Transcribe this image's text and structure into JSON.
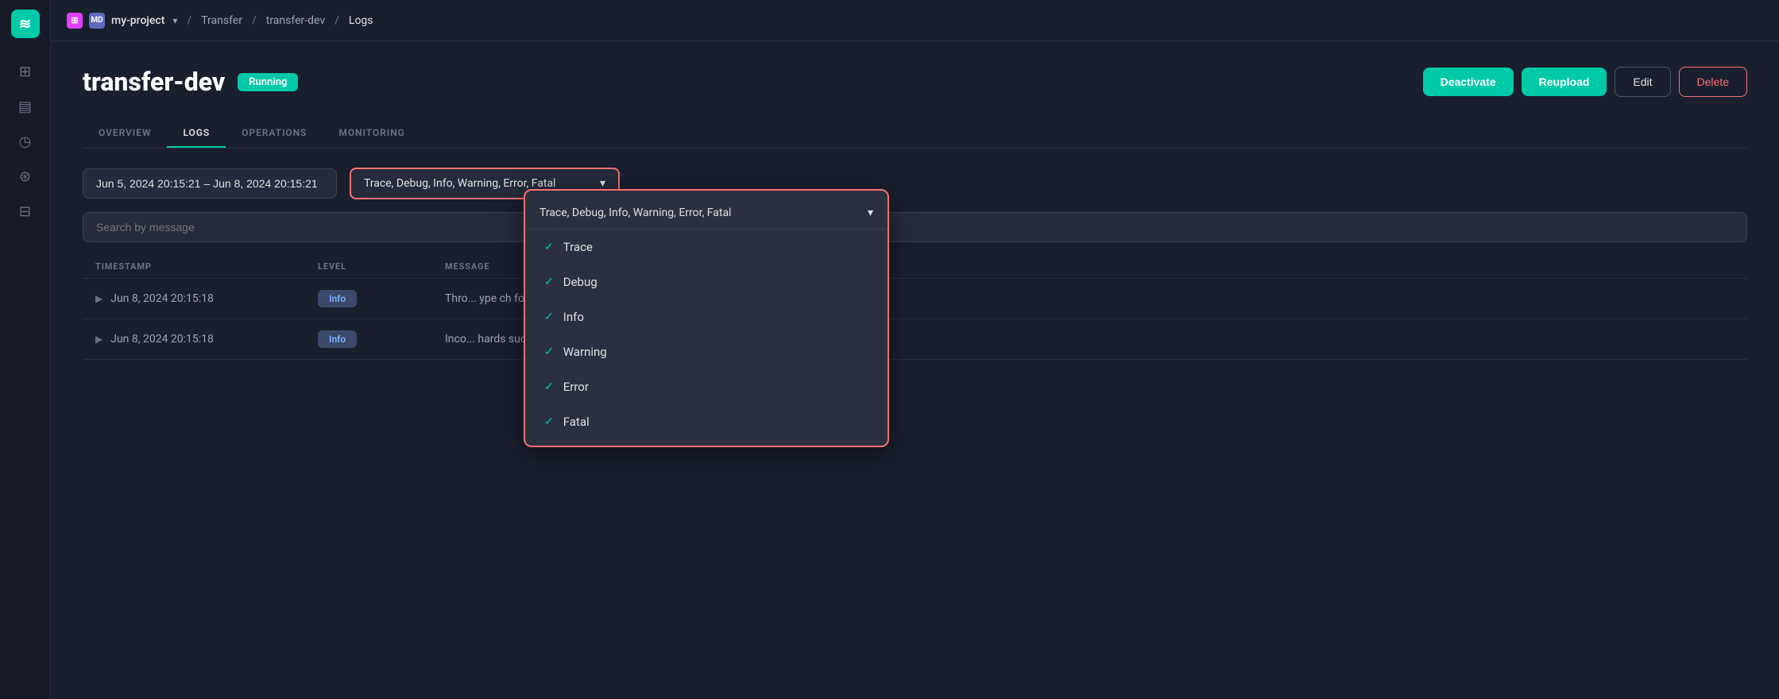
{
  "sidebar": {
    "logo": "≋",
    "icons": [
      {
        "name": "layers-icon",
        "symbol": "⊞"
      },
      {
        "name": "chart-icon",
        "symbol": "⊟"
      },
      {
        "name": "clock-icon",
        "symbol": "◷"
      },
      {
        "name": "network-icon",
        "symbol": "⊛"
      },
      {
        "name": "settings-icon",
        "symbol": "⚙"
      }
    ]
  },
  "topbar": {
    "project_icon": "⊞",
    "project_initials": "MD",
    "project_name": "my-project",
    "breadcrumb": [
      "Transfer",
      "transfer-dev",
      "Logs"
    ]
  },
  "page": {
    "title": "transfer-dev",
    "status": "Running",
    "actions": {
      "deactivate": "Deactivate",
      "reupload": "Reupload",
      "edit": "Edit",
      "delete": "Delete"
    }
  },
  "tabs": [
    {
      "label": "OVERVIEW",
      "active": false
    },
    {
      "label": "LOGS",
      "active": true
    },
    {
      "label": "OPERATIONS",
      "active": false
    },
    {
      "label": "MONITORING",
      "active": false
    }
  ],
  "filters": {
    "date_range": "Jun 5, 2024 20:15:21 – Jun 8, 2024 20:15:21",
    "level_select": "Trace, Debug, Info, Warning, Error, Fatal",
    "search_placeholder": "Search by message"
  },
  "table": {
    "columns": [
      "TIMESTAMP",
      "LEVEL",
      "MESSAGE"
    ],
    "rows": [
      {
        "timestamp": "Jun 8, 2024 20:15:18",
        "level": "Info",
        "message": "Thro... ype ch folder_id interval 1s revision 14154277 sr…"
      },
      {
        "timestamp": "Jun 8, 2024 20:15:18",
        "level": "Info",
        "message": "Inco... hards successfully params component distribu…"
      }
    ]
  },
  "dropdown": {
    "title": "Trace, Debug, Info, Warning, Error, Fatal",
    "items": [
      {
        "label": "Trace",
        "checked": true
      },
      {
        "label": "Debug",
        "checked": true
      },
      {
        "label": "Info",
        "checked": true
      },
      {
        "label": "Warning",
        "checked": true
      },
      {
        "label": "Error",
        "checked": true
      },
      {
        "label": "Fatal",
        "checked": true
      }
    ]
  }
}
